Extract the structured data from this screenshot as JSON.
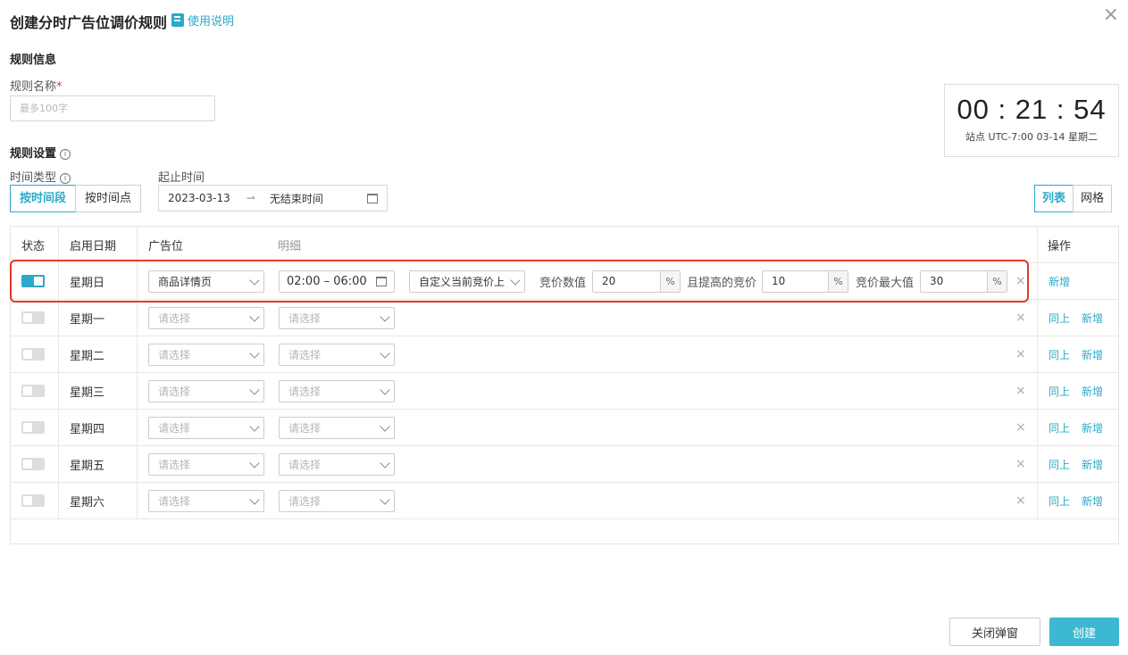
{
  "dialog": {
    "title": "创建分时广告位调价规则",
    "help_label": "使用说明"
  },
  "rule_info": {
    "section_title": "规则信息",
    "name_label": "规则名称",
    "name_required": "*",
    "name_placeholder": "最多100字",
    "name_value": ""
  },
  "clock": {
    "time": "00 : 21 : 54",
    "sub": "站点 UTC-7:00   03-14 星期二"
  },
  "settings": {
    "section_title": "规则设置",
    "time_type_label": "时间类型",
    "time_type_options": [
      "按时间段",
      "按时间点"
    ],
    "time_type_selected": "按时间段",
    "range_label": "起止时间",
    "range_start": "2023-03-13",
    "range_end": "无结束时间",
    "view_options": [
      "列表",
      "网格"
    ],
    "view_selected": "列表"
  },
  "table": {
    "headers": {
      "status": "状态",
      "date": "启用日期",
      "slot": "广告位",
      "detail": "明细",
      "ops": "操作"
    },
    "placeholder": "请选择",
    "rows": [
      {
        "enabled": true,
        "day": "星期日",
        "slot": "商品详情页",
        "time": "02:00 – 06:00",
        "mode": "自定义当前竞价上",
        "bid_label": "竞价数值",
        "bid_value": "20",
        "raise_label": "且提高的竞价",
        "raise_value": "10",
        "max_label": "竞价最大值",
        "max_value": "30",
        "unit": "%",
        "actions": [
          "新增"
        ]
      },
      {
        "enabled": false,
        "day": "星期一",
        "actions": [
          "同上",
          "新增"
        ]
      },
      {
        "enabled": false,
        "day": "星期二",
        "actions": [
          "同上",
          "新增"
        ]
      },
      {
        "enabled": false,
        "day": "星期三",
        "actions": [
          "同上",
          "新增"
        ]
      },
      {
        "enabled": false,
        "day": "星期四",
        "actions": [
          "同上",
          "新增"
        ]
      },
      {
        "enabled": false,
        "day": "星期五",
        "actions": [
          "同上",
          "新增"
        ]
      },
      {
        "enabled": false,
        "day": "星期六",
        "actions": [
          "同上",
          "新增"
        ]
      }
    ]
  },
  "footer": {
    "close_label": "关闭弹窗",
    "create_label": "创建"
  },
  "colors": {
    "accent": "#2aa9c9",
    "primary_button": "#3db8d1",
    "highlight": "#e03a2a"
  }
}
